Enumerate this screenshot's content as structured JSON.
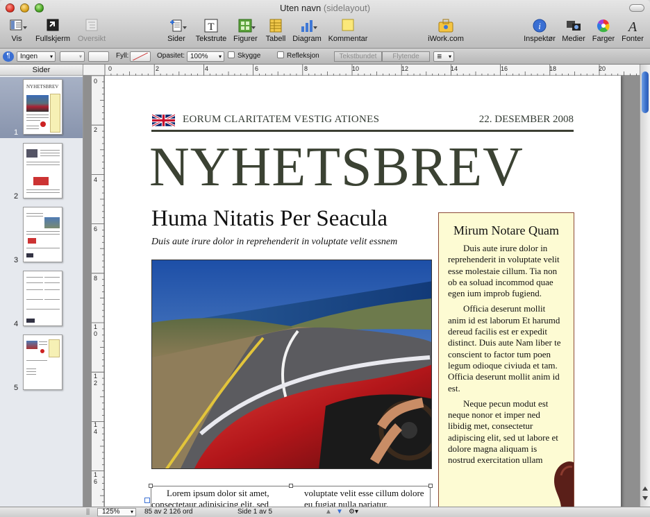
{
  "window": {
    "title": "Uten navn",
    "subtitle": "(sidelayout)"
  },
  "toolbar": {
    "items": [
      {
        "label": "Vis",
        "icon": "view-icon"
      },
      {
        "label": "Fullskjerm",
        "icon": "fullscreen-icon"
      },
      {
        "label": "Oversikt",
        "icon": "outline-icon",
        "disabled": true
      },
      {
        "label": "Sider",
        "icon": "pages-icon"
      },
      {
        "label": "Tekstrute",
        "icon": "textbox-icon"
      },
      {
        "label": "Figurer",
        "icon": "shapes-icon"
      },
      {
        "label": "Tabell",
        "icon": "table-icon"
      },
      {
        "label": "Diagram",
        "icon": "chart-icon"
      },
      {
        "label": "Kommentar",
        "icon": "comment-icon"
      },
      {
        "label": "iWork.com",
        "icon": "iwork-icon"
      },
      {
        "label": "Inspektør",
        "icon": "inspector-icon"
      },
      {
        "label": "Medier",
        "icon": "media-icon"
      },
      {
        "label": "Farger",
        "icon": "colors-icon"
      },
      {
        "label": "Fonter",
        "icon": "fonts-icon"
      }
    ]
  },
  "formatbar": {
    "stroke_style": "Ingen",
    "fill_label": "Fyll:",
    "opacity_label": "Opasitet:",
    "opacity_value": "100%",
    "shadow_label": "Skygge",
    "reflection_label": "Refleksjon",
    "wrap_inline": "Tekstbundet",
    "wrap_floating": "Flytende"
  },
  "sidebar": {
    "title": "Sider",
    "pages": [
      "1",
      "2",
      "3",
      "4",
      "5"
    ],
    "selected": 0
  },
  "ruler": {
    "horizontal": [
      "0",
      "2",
      "4",
      "6",
      "8",
      "10",
      "12",
      "14",
      "16",
      "18",
      "20"
    ],
    "vertical": [
      "0",
      "2",
      "4",
      "6",
      "8",
      "10",
      "12",
      "14",
      "16"
    ]
  },
  "document": {
    "tagline": "EORUM CLARITATEM VESTIG ATIONES",
    "date": "22. DESEMBER 2008",
    "brand": "NYHETSBREV",
    "headline": "Huma Nitatis Per Seacula",
    "deck": "Duis aute irure dolor in reprehenderit in voluptate velit essnem",
    "sidebar_title": "Mirum Notare Quam",
    "sidebar_paragraphs": [
      "Duis aute irure dolor in reprehenderit in voluptate velit esse molestaie cillum. Tia non ob ea soluad incommod quae egen ium improb fugiend.",
      "Officia deserunt mollit anim id est laborum Et harumd dereud facilis est er expedit distinct. Duis aute Nam liber te conscient to factor tum poen legum odioque civiuda et tam. Officia deserunt mollit anim id est.",
      "Neque pecun modut est neque nonor et imper ned libidig met, consectetur adipiscing elit, sed ut labore et dolore magna aliquam is nostrud exercitation ullam"
    ],
    "body_col1_line1": "Lorem ipsum dolor sit amet,",
    "body_col1_line2": "consectetaur adipisicing elit, sed",
    "body_col2_line1": "voluptate velit esse cillum dolore",
    "body_col2_line2": "eu fugiat nulla pariatur."
  },
  "status": {
    "zoom": "125%",
    "word_count": "85 av 2 126 ord",
    "page_info": "Side 1 av 5"
  }
}
